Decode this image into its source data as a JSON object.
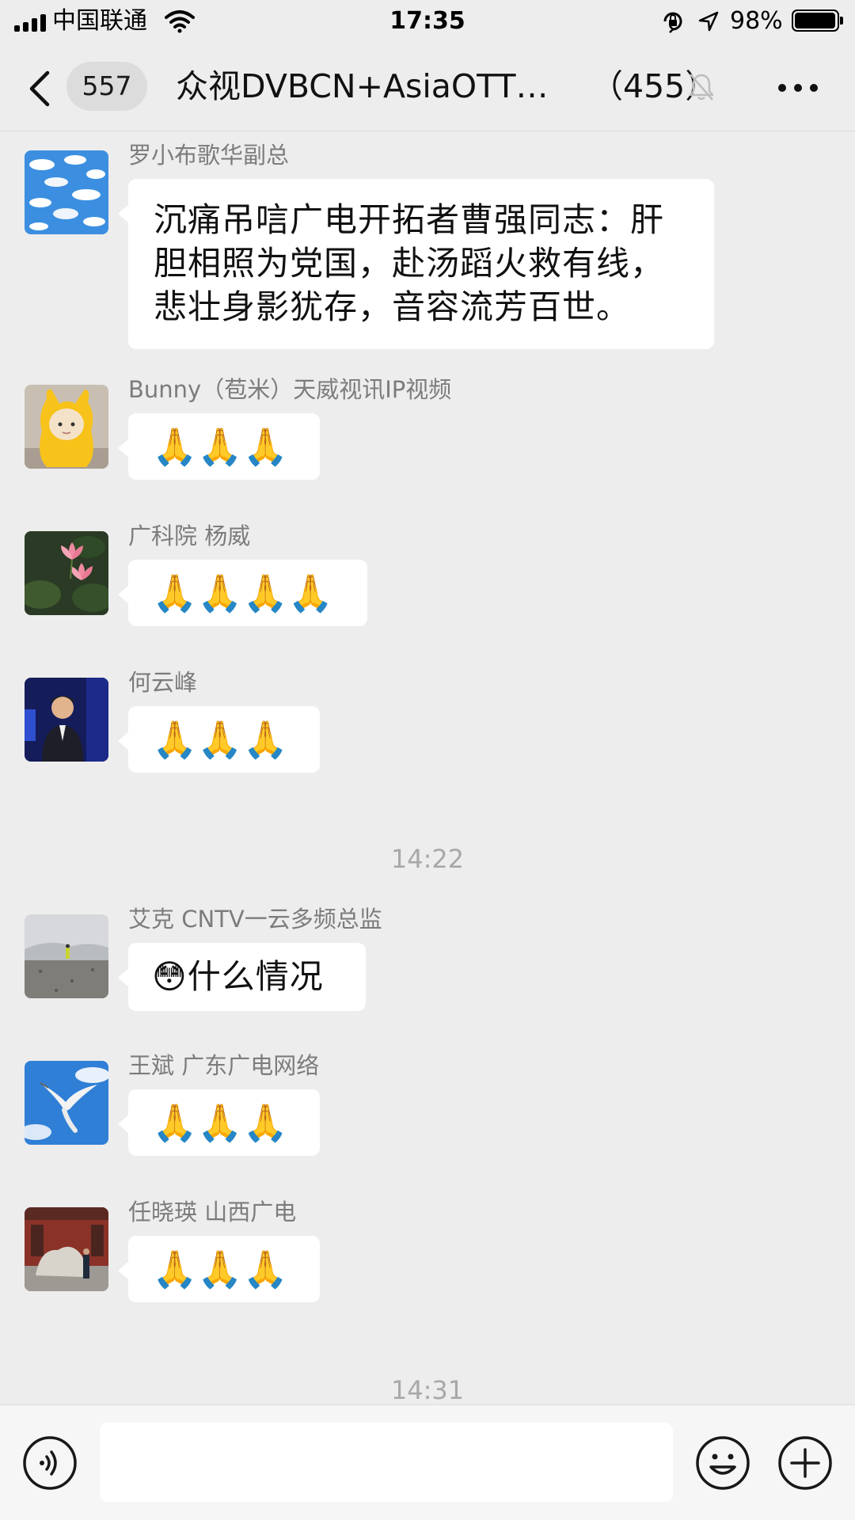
{
  "status_bar": {
    "carrier": "中国联通",
    "time": "17:35",
    "battery_percent_label": "98%",
    "battery_level": 0.98,
    "signal_bars": 4
  },
  "header": {
    "unread_count": "557",
    "title": "众视DVBCN+AsiaOTT…",
    "member_count": "（455）",
    "icons": [
      "back-chevron-icon",
      "bell-muted-icon",
      "more-dots-icon"
    ]
  },
  "messages": [
    {
      "sender": "罗小布歌华副总",
      "avatar": "sky-clouds-avatar",
      "text": "沉痛吊唁广电开拓者曹强同志：肝胆相照为党国，赴汤蹈火救有线，悲壮身影犹存，音容流芳百世。"
    },
    {
      "sender": "Bunny（苞米）天威视讯IP视频",
      "avatar": "yellow-raincoat-doll-avatar",
      "text": "🙏🙏🙏"
    },
    {
      "sender": "广科院 杨威",
      "avatar": "lotus-flower-avatar",
      "text": "🙏🙏🙏🙏"
    },
    {
      "sender": "何云峰",
      "avatar": "speaker-on-stage-avatar",
      "text": "🙏🙏🙏"
    },
    {
      "sender": "艾克 CNTV一云多频总监",
      "avatar": "rocky-mountain-avatar",
      "text": "😳什么情况"
    },
    {
      "sender": "王斌 广东广电网络",
      "avatar": "seagull-sky-avatar",
      "text": "🙏🙏🙏"
    },
    {
      "sender": "任晓瑛 山西广电",
      "avatar": "stone-statue-avatar",
      "text": "🙏🙏🙏"
    }
  ],
  "timestamps": [
    "14:22",
    "14:31"
  ],
  "input_bar": {
    "value": "",
    "icons": [
      "voice-icon",
      "emoji-icon",
      "plus-icon"
    ]
  }
}
